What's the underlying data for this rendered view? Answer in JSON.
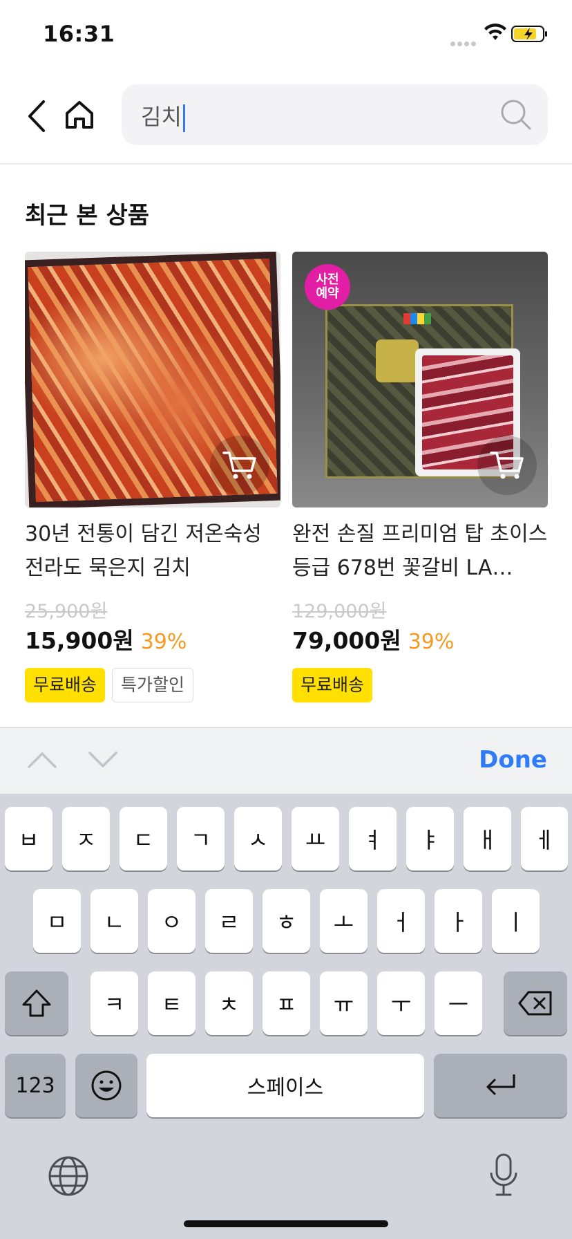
{
  "status_bar": {
    "time": "16:31"
  },
  "search": {
    "value": "김치"
  },
  "recent": {
    "title": "최근 본 상품",
    "items": [
      {
        "name": "30년 전통이 담긴 저온숙성 전라도 묵은지 김치",
        "original_price": "25,900원",
        "price": "15,900원",
        "discount": "39%",
        "tags": [
          "무료배송",
          "특가할인"
        ]
      },
      {
        "badge": "사전\n예약",
        "name": "완전 손질 프리미엄 탑 초이스 등급 678번 꽃갈비 LA…",
        "original_price": "129,000원",
        "price": "79,000원",
        "discount": "39%",
        "tags": [
          "무료배송"
        ]
      }
    ]
  },
  "accessory": {
    "done_label": "Done"
  },
  "keyboard": {
    "row1": [
      "ㅂ",
      "ㅈ",
      "ㄷ",
      "ㄱ",
      "ㅅ",
      "ㅛ",
      "ㅕ",
      "ㅑ",
      "ㅐ",
      "ㅔ"
    ],
    "row2": [
      "ㅁ",
      "ㄴ",
      "ㅇ",
      "ㄹ",
      "ㅎ",
      "ㅗ",
      "ㅓ",
      "ㅏ",
      "ㅣ"
    ],
    "row3": [
      "ㅋ",
      "ㅌ",
      "ㅊ",
      "ㅍ",
      "ㅠ",
      "ㅜ",
      "ㅡ"
    ],
    "numbers_label": "123",
    "space_label": "스페이스"
  },
  "colors": {
    "accent": "#2f7cf6",
    "discount": "#f59a23",
    "tag_yellow": "#ffe000"
  },
  "icons": [
    "back-icon",
    "home-icon",
    "search-icon",
    "cart-icon",
    "chevron-up-icon",
    "chevron-down-icon",
    "shift-icon",
    "delete-icon",
    "emoji-icon",
    "return-icon",
    "globe-icon",
    "mic-icon"
  ]
}
